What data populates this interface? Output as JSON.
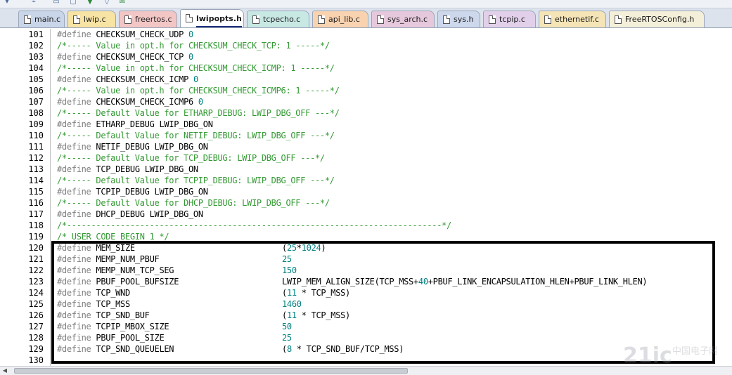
{
  "tabs": [
    {
      "label": "main.c",
      "color": "#c9d5e8"
    },
    {
      "label": "lwip.c",
      "color": "#f7e3a4"
    },
    {
      "label": "freertos.c",
      "color": "#f3c6c6"
    },
    {
      "label": "lwipopts.h",
      "color": "#ffffff"
    },
    {
      "label": "tcpecho.c",
      "color": "#c8e8e4"
    },
    {
      "label": "api_lib.c",
      "color": "#f9d3b0"
    },
    {
      "label": "sys_arch.c",
      "color": "#e6c8dc"
    },
    {
      "label": "sys.h",
      "color": "#cdd8ec"
    },
    {
      "label": "tcpip.c",
      "color": "#e2d0ea"
    },
    {
      "label": "ethernetif.c",
      "color": "#f4e4b6"
    },
    {
      "label": "FreeRTOSConfig.h",
      "color": "#f4efd9"
    }
  ],
  "active_tab": "lwipopts.h",
  "colors": {
    "keyword": "#808080",
    "number": "#008080",
    "comment": "#339933",
    "text": "#000000"
  },
  "editor": {
    "lines": [
      {
        "no": "101",
        "kind": "def",
        "name": "CHECKSUM_CHECK_UDP",
        "value": "0"
      },
      {
        "no": "102",
        "kind": "comment",
        "text": "/*----- Value in opt.h for CHECKSUM_CHECK_TCP: 1 -----*/"
      },
      {
        "no": "103",
        "kind": "def",
        "name": "CHECKSUM_CHECK_TCP",
        "value": "0"
      },
      {
        "no": "104",
        "kind": "comment",
        "text": "/*----- Value in opt.h for CHECKSUM_CHECK_ICMP: 1 -----*/"
      },
      {
        "no": "105",
        "kind": "def",
        "name": "CHECKSUM_CHECK_ICMP",
        "value": "0"
      },
      {
        "no": "106",
        "kind": "comment",
        "text": "/*----- Value in opt.h for CHECKSUM_CHECK_ICMP6: 1 -----*/"
      },
      {
        "no": "107",
        "kind": "def",
        "name": "CHECKSUM_CHECK_ICMP6",
        "value": "0"
      },
      {
        "no": "108",
        "kind": "comment",
        "text": "/*----- Default Value for ETHARP_DEBUG: LWIP_DBG_OFF ---*/"
      },
      {
        "no": "109",
        "kind": "def",
        "name": "ETHARP_DEBUG",
        "value": "LWIP_DBG_ON"
      },
      {
        "no": "110",
        "kind": "comment",
        "text": "/*----- Default Value for NETIF_DEBUG: LWIP_DBG_OFF ---*/"
      },
      {
        "no": "111",
        "kind": "def",
        "name": "NETIF_DEBUG",
        "value": "LWIP_DBG_ON"
      },
      {
        "no": "112",
        "kind": "comment",
        "text": "/*----- Default Value for TCP_DEBUG: LWIP_DBG_OFF ---*/"
      },
      {
        "no": "113",
        "kind": "def",
        "name": "TCP_DEBUG",
        "value": "LWIP_DBG_ON"
      },
      {
        "no": "114",
        "kind": "comment",
        "text": "/*----- Default Value for TCPIP_DEBUG: LWIP_DBG_OFF ---*/"
      },
      {
        "no": "115",
        "kind": "def",
        "name": "TCPIP_DEBUG",
        "value": "LWIP_DBG_ON"
      },
      {
        "no": "116",
        "kind": "comment",
        "text": "/*----- Default Value for DHCP_DEBUG: LWIP_DBG_OFF ---*/"
      },
      {
        "no": "117",
        "kind": "def",
        "name": "DHCP_DEBUG",
        "value": "LWIP_DBG_ON"
      },
      {
        "no": "118",
        "kind": "comment",
        "text": "/*-----------------------------------------------------------------------------*/"
      },
      {
        "no": "119",
        "kind": "comment",
        "text": "/* USER CODE BEGIN 1 */"
      },
      {
        "no": "120",
        "kind": "def2",
        "name": "MEM_SIZE",
        "value": "(25*1024)"
      },
      {
        "no": "121",
        "kind": "def2",
        "name": "MEMP_NUM_PBUF",
        "value": "25"
      },
      {
        "no": "122",
        "kind": "def2",
        "name": "MEMP_NUM_TCP_SEG",
        "value": "150"
      },
      {
        "no": "123",
        "kind": "def2",
        "name": "PBUF_POOL_BUFSIZE",
        "value": "LWIP_MEM_ALIGN_SIZE(TCP_MSS+40+PBUF_LINK_ENCAPSULATION_HLEN+PBUF_LINK_HLEN)"
      },
      {
        "no": "124",
        "kind": "def2",
        "name": "TCP_WND",
        "value": "(11 * TCP_MSS)"
      },
      {
        "no": "125",
        "kind": "def2",
        "name": "TCP_MSS",
        "value": "1460"
      },
      {
        "no": "126",
        "kind": "def2",
        "name": "TCP_SND_BUF",
        "value": "(11 * TCP_MSS)"
      },
      {
        "no": "127",
        "kind": "def2",
        "name": "TCPIP_MBOX_SIZE",
        "value": "50"
      },
      {
        "no": "128",
        "kind": "def2",
        "name": "PBUF_POOL_SIZE",
        "value": "25"
      },
      {
        "no": "129",
        "kind": "def2",
        "name": "TCP_SND_QUEUELEN",
        "value": "(8 * TCP_SND_BUF/TCP_MSS)"
      },
      {
        "no": "130",
        "kind": "blank"
      }
    ]
  },
  "keyword": "#define",
  "toolbar": {
    "icons": [
      "dropdown-icon",
      "bookmark-icon",
      "bookmark-clear-icon",
      "download-icon",
      "filter-icon",
      "mail-icon"
    ]
  },
  "watermark": {
    "text": "21ic",
    "subtitle": "中国电子网"
  }
}
